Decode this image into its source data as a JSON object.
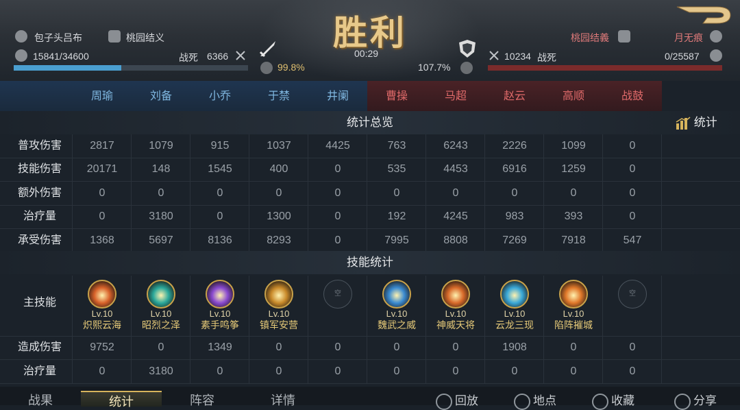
{
  "header": {
    "title": "胜利",
    "timer": "00:29",
    "left": {
      "player_name": "包子头吕布",
      "alliance": "桃园结义",
      "troops": "15841/34600",
      "killed_label": "战死",
      "killed_value": "6366",
      "ratio": "99.8%",
      "hp_fraction": 0.458
    },
    "right": {
      "player_name": "月无痕",
      "alliance": "桃园结義",
      "troops": "0/25587",
      "killed_value": "10234",
      "killed_label": "战死",
      "ratio": "107.7%",
      "hp_fraction": 0.0
    }
  },
  "heroes_left": [
    "周瑜",
    "刘备",
    "小乔",
    "于禁",
    "井阑"
  ],
  "heroes_right": [
    "曹操",
    "马超",
    "赵云",
    "高顺",
    "战鼓"
  ],
  "colors": {
    "left_team": "#7fb7e0",
    "right_team": "#e06a6a",
    "accent": "#d7b45c"
  },
  "overview": {
    "title": "统计总览",
    "stats_button": "统计",
    "rows": [
      {
        "label": "普攻伤害",
        "values": [
          "2817",
          "1079",
          "915",
          "1037",
          "4425",
          "763",
          "6243",
          "2226",
          "1099",
          "0"
        ]
      },
      {
        "label": "技能伤害",
        "values": [
          "20171",
          "148",
          "1545",
          "400",
          "0",
          "535",
          "4453",
          "6916",
          "1259",
          "0"
        ]
      },
      {
        "label": "额外伤害",
        "values": [
          "0",
          "0",
          "0",
          "0",
          "0",
          "0",
          "0",
          "0",
          "0",
          "0"
        ]
      },
      {
        "label": "治疗量",
        "values": [
          "0",
          "3180",
          "0",
          "1300",
          "0",
          "192",
          "4245",
          "983",
          "393",
          "0"
        ]
      },
      {
        "label": "承受伤害",
        "values": [
          "1368",
          "5697",
          "8136",
          "8293",
          "0",
          "7995",
          "8808",
          "7269",
          "7918",
          "547"
        ]
      }
    ]
  },
  "skills": {
    "title": "技能统计",
    "main_label": "主技能",
    "empty_label": "空",
    "items": [
      {
        "level": "Lv.10",
        "name": "炽熙云海",
        "color": "#d8622a",
        "empty": false
      },
      {
        "level": "Lv.10",
        "name": "昭烈之泽",
        "color": "#2aa89a",
        "empty": false
      },
      {
        "level": "Lv.10",
        "name": "素手鸣筝",
        "color": "#8a4ad0",
        "empty": false
      },
      {
        "level": "Lv.10",
        "name": "镇军安营",
        "color": "#c98a2a",
        "empty": false
      },
      {
        "level": "",
        "name": "",
        "color": "",
        "empty": true
      },
      {
        "level": "Lv.10",
        "name": "魏武之威",
        "color": "#3a8ad0",
        "empty": false
      },
      {
        "level": "Lv.10",
        "name": "神威天将",
        "color": "#d86a2a",
        "empty": false
      },
      {
        "level": "Lv.10",
        "name": "云龙三现",
        "color": "#3aa8d8",
        "empty": false
      },
      {
        "level": "Lv.10",
        "name": "陷阵摧城",
        "color": "#e0782a",
        "empty": false
      },
      {
        "level": "",
        "name": "",
        "color": "",
        "empty": true
      }
    ],
    "rows": [
      {
        "label": "造成伤害",
        "values": [
          "9752",
          "0",
          "1349",
          "0",
          "0",
          "0",
          "0",
          "1908",
          "0",
          "0"
        ]
      },
      {
        "label": "治疗量",
        "values": [
          "0",
          "3180",
          "0",
          "0",
          "0",
          "0",
          "0",
          "0",
          "0",
          "0"
        ]
      }
    ]
  },
  "bottom": {
    "tabs": [
      "战果",
      "统计",
      "阵容",
      "详情"
    ],
    "active_tab": 1,
    "actions": [
      "回放",
      "地点",
      "收藏",
      "分享"
    ]
  }
}
